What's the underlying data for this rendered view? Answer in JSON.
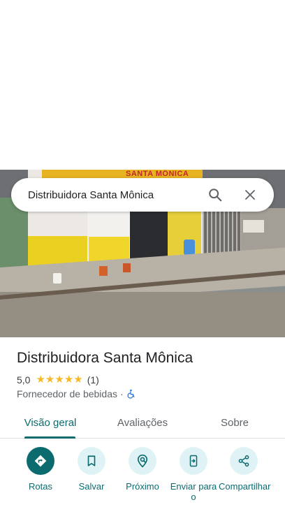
{
  "search": {
    "query": "Distribuidora Santa Mônica",
    "search_icon": "search-icon",
    "close_icon": "close-icon"
  },
  "photo": {
    "sign_text": "SANTA MÔNICA"
  },
  "place": {
    "title": "Distribuidora Santa Mônica",
    "rating": "5,0",
    "stars": 5,
    "review_count": "(1)",
    "category": "Fornecedor de bebidas",
    "separator": "·",
    "accessibility_icon": "wheelchair-icon"
  },
  "tabs": [
    {
      "label": "Visão geral",
      "selected": true
    },
    {
      "label": "Avaliações",
      "selected": false
    },
    {
      "label": "Sobre",
      "selected": false
    }
  ],
  "actions": [
    {
      "label": "Rotas",
      "icon": "directions-icon"
    },
    {
      "label": "Salvar",
      "icon": "bookmark-icon"
    },
    {
      "label": "Próximo",
      "icon": "nearby-icon"
    },
    {
      "label": "Enviar para o",
      "icon": "send-to-phone-icon"
    },
    {
      "label": "Compartilhar",
      "icon": "share-icon"
    }
  ],
  "colors": {
    "accent": "#0b6b6f",
    "action_bg": "#dff3f6",
    "star": "#f7b928"
  }
}
